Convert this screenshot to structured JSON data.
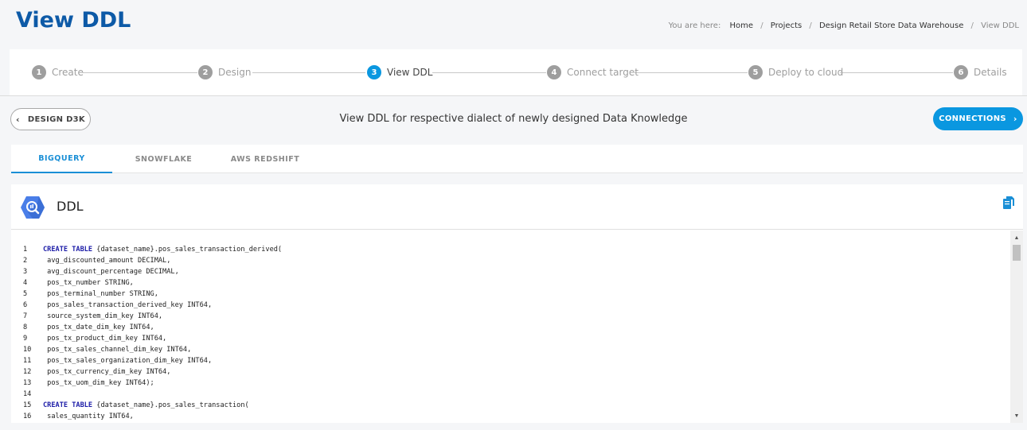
{
  "header": {
    "title": "View DDL",
    "breadcrumb": {
      "prefix": "You are here:",
      "items": [
        "Home",
        "Projects",
        "Design Retail Store Data Warehouse",
        "View DDL"
      ]
    }
  },
  "stepper": {
    "steps": [
      {
        "num": "1",
        "label": "Create"
      },
      {
        "num": "2",
        "label": "Design"
      },
      {
        "num": "3",
        "label": "View DDL"
      },
      {
        "num": "4",
        "label": "Connect target"
      },
      {
        "num": "5",
        "label": "Deploy to cloud"
      },
      {
        "num": "6",
        "label": "Details"
      }
    ],
    "active_step": "3"
  },
  "toolbar": {
    "back_label": "DESIGN D3K",
    "message": "View DDL for respective dialect of newly designed Data Knowledge",
    "connections_label": "CONNECTIONS"
  },
  "tabs": [
    {
      "label": "BIGQUERY"
    },
    {
      "label": "SNOWFLAKE"
    },
    {
      "label": "AWS REDSHIFT"
    }
  ],
  "active_tab": "BIGQUERY",
  "ddl": {
    "title": "DDL",
    "icons": {
      "engine": "bigquery-icon",
      "copy": "copy-icon"
    },
    "lines": [
      {
        "n": "1",
        "kw": "CREATE TABLE",
        "rest": " {dataset_name}.pos_sales_transaction_derived("
      },
      {
        "n": "2",
        "kw": "",
        "rest": " avg_discounted_amount DECIMAL,"
      },
      {
        "n": "3",
        "kw": "",
        "rest": " avg_discount_percentage DECIMAL,"
      },
      {
        "n": "4",
        "kw": "",
        "rest": " pos_tx_number STRING,"
      },
      {
        "n": "5",
        "kw": "",
        "rest": " pos_terminal_number STRING,"
      },
      {
        "n": "6",
        "kw": "",
        "rest": " pos_sales_transaction_derived_key INT64,"
      },
      {
        "n": "7",
        "kw": "",
        "rest": " source_system_dim_key INT64,"
      },
      {
        "n": "8",
        "kw": "",
        "rest": " pos_tx_date_dim_key INT64,"
      },
      {
        "n": "9",
        "kw": "",
        "rest": " pos_tx_product_dim_key INT64,"
      },
      {
        "n": "10",
        "kw": "",
        "rest": " pos_tx_sales_channel_dim_key INT64,"
      },
      {
        "n": "11",
        "kw": "",
        "rest": " pos_tx_sales_organization_dim_key INT64,"
      },
      {
        "n": "12",
        "kw": "",
        "rest": " pos_tx_currency_dim_key INT64,"
      },
      {
        "n": "13",
        "kw": "",
        "rest": " pos_tx_uom_dim_key INT64);"
      },
      {
        "n": "14",
        "kw": "",
        "rest": ""
      },
      {
        "n": "15",
        "kw": "CREATE TABLE",
        "rest": " {dataset_name}.pos_sales_transaction("
      },
      {
        "n": "16",
        "kw": "",
        "rest": " sales_quantity INT64,"
      }
    ]
  },
  "colors": {
    "accent": "#0a97e0",
    "title": "#0d5aa7",
    "bigquery": "#4a7ee8"
  }
}
